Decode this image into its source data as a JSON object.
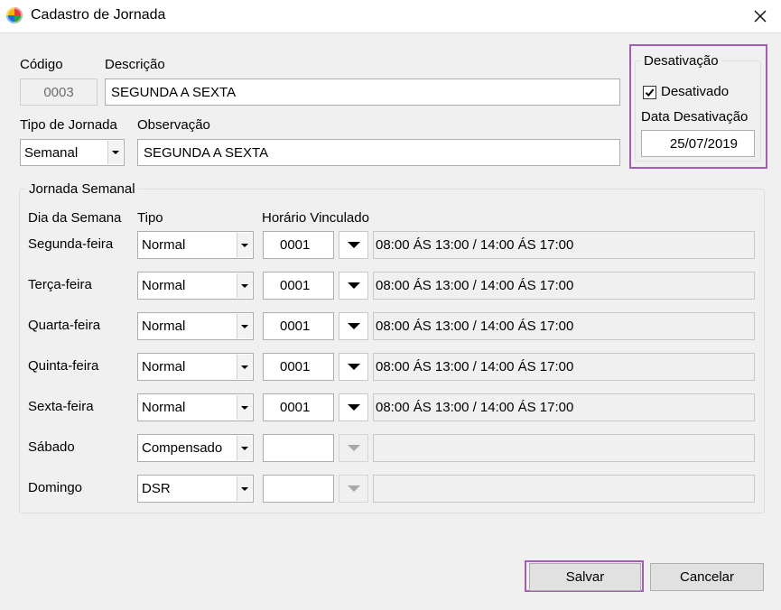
{
  "window": {
    "title": "Cadastro de Jornada",
    "close_icon": "close-icon",
    "app_icon": "app-icon"
  },
  "codigo": {
    "label": "Código",
    "value": "0003"
  },
  "descricao": {
    "label": "Descrição",
    "value": "SEGUNDA A SEXTA"
  },
  "tipo_jornada": {
    "label": "Tipo de Jornada",
    "value": "Semanal"
  },
  "observacao": {
    "label": "Observação",
    "value": "SEGUNDA A SEXTA"
  },
  "desativacao": {
    "title": "Desativação",
    "checkbox_label": "Desativado",
    "checked": true,
    "date_label": "Data Desativação",
    "date_value": "25/07/2019"
  },
  "jornada_semanal": {
    "title": "Jornada Semanal",
    "headers": {
      "dia": "Dia da Semana",
      "tipo": "Tipo",
      "horario": "Horário Vinculado"
    },
    "rows": [
      {
        "dia": "Segunda-feira",
        "tipo": "Normal",
        "codigo": "0001",
        "horario": "08:00 ÁS 13:00 / 14:00 ÁS 17:00"
      },
      {
        "dia": "Terça-feira",
        "tipo": "Normal",
        "codigo": "0001",
        "horario": "08:00 ÁS 13:00 / 14:00 ÁS 17:00"
      },
      {
        "dia": "Quarta-feira",
        "tipo": "Normal",
        "codigo": "0001",
        "horario": "08:00 ÁS 13:00 / 14:00 ÁS 17:00"
      },
      {
        "dia": "Quinta-feira",
        "tipo": "Normal",
        "codigo": "0001",
        "horario": "08:00 ÁS 13:00 / 14:00 ÁS 17:00"
      },
      {
        "dia": "Sexta-feira",
        "tipo": "Normal",
        "codigo": "0001",
        "horario": "08:00 ÁS 13:00 / 14:00 ÁS 17:00"
      },
      {
        "dia": "Sábado",
        "tipo": "Compensado",
        "codigo": "",
        "horario": ""
      },
      {
        "dia": "Domingo",
        "tipo": "DSR",
        "codigo": "",
        "horario": ""
      }
    ]
  },
  "buttons": {
    "salvar": "Salvar",
    "cancelar": "Cancelar"
  },
  "colors": {
    "highlight": "#a35cb8",
    "background": "#f0f0f0"
  }
}
